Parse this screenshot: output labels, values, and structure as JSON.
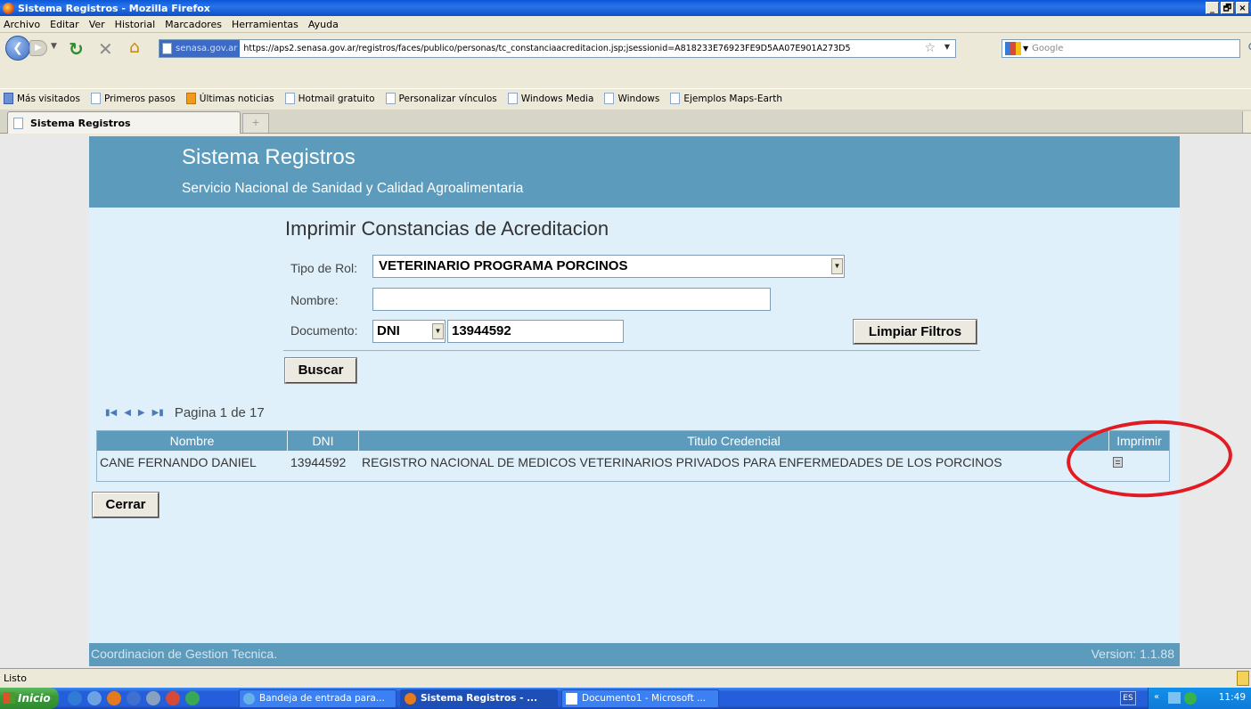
{
  "window": {
    "title": "Sistema Registros - Mozilla Firefox",
    "controls": [
      "_",
      "🗗",
      "×"
    ]
  },
  "menu": [
    "Archivo",
    "Editar",
    "Ver",
    "Historial",
    "Marcadores",
    "Herramientas",
    "Ayuda"
  ],
  "nav": {
    "site_badge": "senasa.gov.ar",
    "url": "https://aps2.senasa.gov.ar/registros/faces/publico/personas/tc_constanciaacreditacion.jsp;jsessionid=A818233E76923FE9D5AA07E901A273D5",
    "search_placeholder": "Google"
  },
  "bookmarks": [
    "Más visitados",
    "Primeros pasos",
    "Últimas noticias",
    "Hotmail gratuito",
    "Personalizar vínculos",
    "Windows Media",
    "Windows",
    "Ejemplos Maps-Earth"
  ],
  "tab": {
    "title": "Sistema Registros",
    "new_tab_symbol": "+"
  },
  "app": {
    "title": "Sistema Registros",
    "subtitle": "Servicio Nacional de Sanidad y Calidad Agroalimentaria",
    "page_title": "Imprimir Constancias de Acreditacion",
    "form": {
      "rol_label": "Tipo de Rol:",
      "rol_value": "VETERINARIO PROGRAMA PORCINOS",
      "nombre_label": "Nombre:",
      "nombre_value": "",
      "doc_label": "Documento:",
      "doc_type": "DNI",
      "doc_number": "13944592",
      "limpiar_button": "Limpiar Filtros",
      "buscar_button": "Buscar"
    },
    "pager": {
      "text": "Pagina 1 de 17"
    },
    "table": {
      "headers": [
        "Nombre",
        "DNI",
        "Titulo Credencial",
        "Imprimir"
      ],
      "rows": [
        {
          "nombre": "CANE FERNANDO DANIEL",
          "dni": "13944592",
          "titulo": "REGISTRO NACIONAL DE MEDICOS VETERINARIOS PRIVADOS PARA ENFERMEDADES DE LOS PORCINOS"
        }
      ]
    },
    "cerrar_button": "Cerrar",
    "footer_left": "Coordinacion de Gestion Tecnica.",
    "footer_right": "Version: 1.1.88"
  },
  "status": "Listo",
  "taskbar": {
    "start": "Inicio",
    "tasks": [
      "Bandeja de entrada para...",
      "Sistema Registros - ...",
      "Documento1 - Microsoft ..."
    ],
    "lang": "ES",
    "clock": "11:49"
  },
  "colors": {
    "header_blue": "#5d9bbd",
    "panel_bg": "#dff0fb",
    "annotation_red": "#e21b23"
  }
}
